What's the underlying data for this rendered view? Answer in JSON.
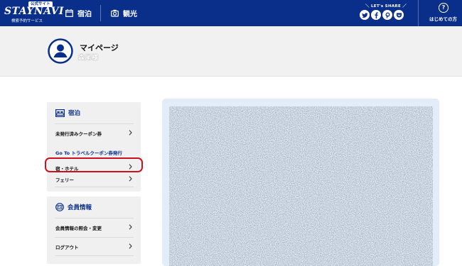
{
  "header": {
    "logo_badge": "公式サイト",
    "logo_text": "STAYNAVI",
    "logo_subtitle": "検索予約サービス",
    "nav": [
      {
        "label": "宿泊",
        "icon": "calendar-icon"
      },
      {
        "label": "観光",
        "icon": "camera-icon"
      }
    ],
    "share_label": "LET's SHARE",
    "share_icons": [
      "twitter-icon",
      "facebook-icon",
      "pinterest-icon",
      "pocket-icon"
    ],
    "help_label": "はじめての方",
    "help_icon": "question-icon"
  },
  "banner": {
    "title": "マイページ",
    "user_name": "森尾様"
  },
  "sidebar": {
    "stay": {
      "heading": "宿泊",
      "items": [
        {
          "label": "未発行済みクーポン券"
        },
        {
          "label": "Go To トラベルクーポン券発行"
        },
        {
          "label": "宿・ホテル"
        },
        {
          "label": "フェリー"
        }
      ]
    },
    "member": {
      "heading": "会員情報",
      "items": [
        {
          "label": "会員情報の照会・変更"
        },
        {
          "label": "ログアウト"
        }
      ]
    }
  },
  "colors": {
    "header_bg": "#0a2f8a",
    "banner_bg": "#f1f1f1",
    "highlight": "#cc1020",
    "content_bg": "#e2edf9"
  }
}
